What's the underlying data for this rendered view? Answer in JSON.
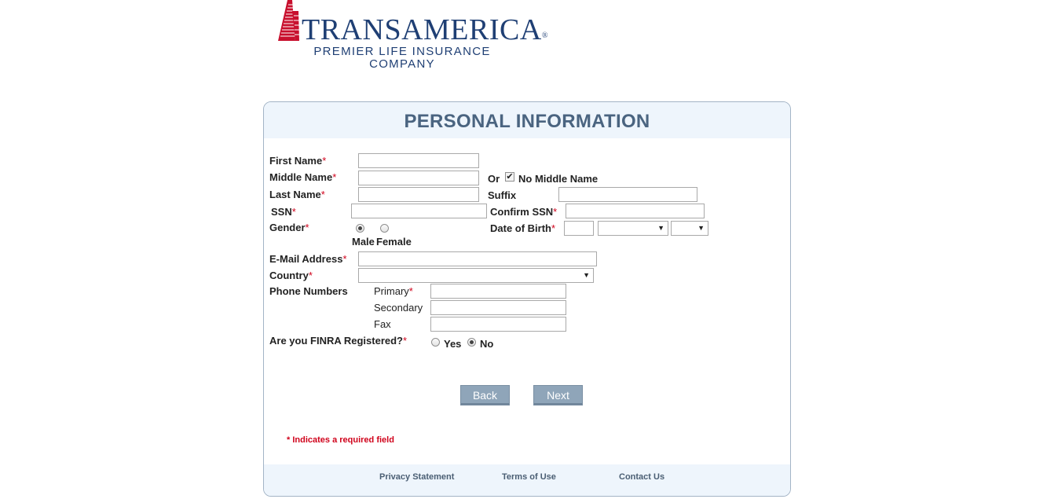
{
  "brand": {
    "name": "TRANSAMERICA",
    "registered": "®",
    "subtitle_line1": "PREMIER LIFE INSURANCE",
    "subtitle_line2": "COMPANY"
  },
  "form": {
    "title": "PERSONAL INFORMATION",
    "required_mark": "*",
    "first_name": {
      "label": "First Name",
      "value": ""
    },
    "middle_name": {
      "label": "Middle Name",
      "value": ""
    },
    "or_text": "Or",
    "no_middle_name": {
      "label": "No Middle Name",
      "checked": true
    },
    "last_name": {
      "label": "Last Name",
      "value": ""
    },
    "suffix": {
      "label": "Suffix",
      "value": ""
    },
    "ssn": {
      "label": "SSN",
      "value": ""
    },
    "confirm_ssn": {
      "label": "Confirm SSN",
      "value": ""
    },
    "gender": {
      "label": "Gender",
      "options": [
        "Male",
        "Female"
      ],
      "selected": "Male"
    },
    "dob": {
      "label": "Date of Birth",
      "day": "",
      "month": "",
      "year": ""
    },
    "email": {
      "label": "E-Mail Address",
      "value": ""
    },
    "country": {
      "label": "Country",
      "value": ""
    },
    "phone": {
      "label": "Phone Numbers",
      "primary_label": "Primary",
      "secondary_label": "Secondary",
      "fax_label": "Fax"
    },
    "finra": {
      "label": "Are you FINRA Registered?",
      "options": [
        "Yes",
        "No"
      ],
      "selected": "No"
    },
    "back_label": "Back",
    "next_label": "Next",
    "required_note": "* Indicates a required field"
  },
  "footer": {
    "privacy": "Privacy Statement",
    "terms": "Terms of Use",
    "contact": "Contact Us"
  },
  "colors": {
    "brand_blue": "#1f3f74",
    "brand_red": "#c8102e",
    "title_color": "#4a6480",
    "required_red": "#d0021b",
    "button_bg": "#8fa5b9",
    "panel_tint": "#eef5fc"
  }
}
